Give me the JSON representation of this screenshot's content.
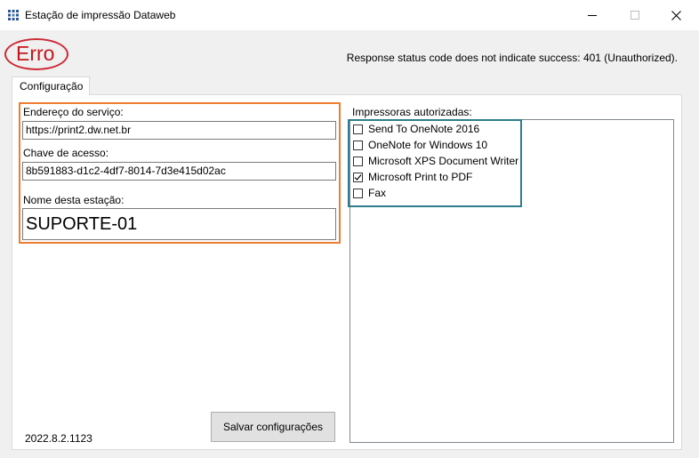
{
  "window": {
    "title": "Estação de impressão Dataweb"
  },
  "header": {
    "error_label": "Erro",
    "status_message": "Response status code does not indicate success: 401 (Unauthorized)."
  },
  "tabs": [
    {
      "label": "Configuração",
      "selected": true
    }
  ],
  "form": {
    "service_address_label": "Endereço do serviço:",
    "service_address_value": "https://print2.dw.net.br",
    "access_key_label": "Chave de acesso:",
    "access_key_value": "8b591883-d1c2-4df7-8014-7d3e415d02ac",
    "station_name_label": "Nome desta estação:",
    "station_name_value": "SUPORTE-01"
  },
  "printers": {
    "label": "Impressoras autorizadas:",
    "items": [
      {
        "name": "Send To OneNote 2016",
        "checked": false
      },
      {
        "name": "OneNote for Windows 10",
        "checked": false
      },
      {
        "name": "Microsoft XPS Document Writer",
        "checked": false
      },
      {
        "name": "Microsoft Print to PDF",
        "checked": true
      },
      {
        "name": "Fax",
        "checked": false
      }
    ]
  },
  "footer": {
    "save_label": "Salvar configurações",
    "version": "2022.8.2.1123"
  },
  "colors": {
    "error_red": "#c4161c",
    "highlight_orange": "#ed7d31",
    "highlight_teal": "#2e7d8c",
    "window_bg": "#f0f0f0"
  },
  "icons": {
    "app": "printer-grid-icon",
    "minimize": "minimize-icon",
    "maximize": "maximize-icon",
    "close": "close-icon",
    "check": "checkmark-icon"
  }
}
